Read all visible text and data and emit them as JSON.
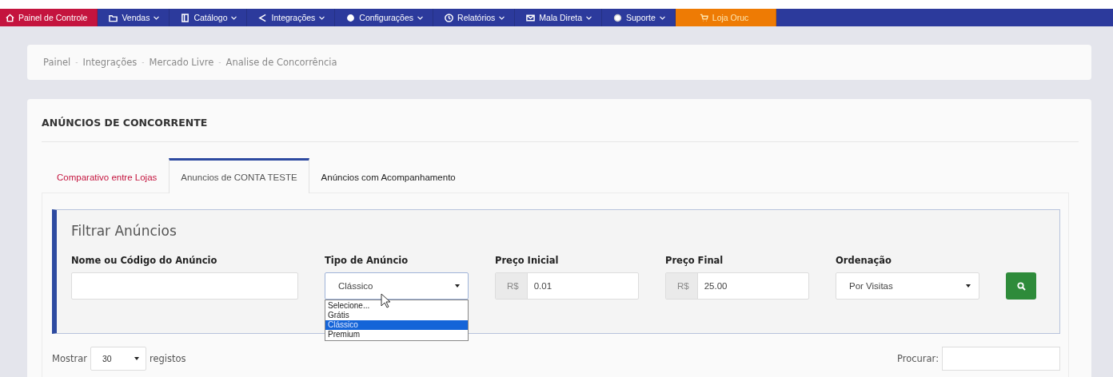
{
  "nav": [
    {
      "label": "Painel de Controle",
      "kind": "home",
      "caret": false
    },
    {
      "label": "Vendas",
      "kind": "menu",
      "caret": true
    },
    {
      "label": "Catálogo",
      "kind": "menu",
      "caret": true
    },
    {
      "label": "Integrações",
      "kind": "menu",
      "caret": true
    },
    {
      "label": "Configurações",
      "kind": "menu",
      "caret": true
    },
    {
      "label": "Relatórios",
      "kind": "menu",
      "caret": true
    },
    {
      "label": "Mala Direta",
      "kind": "menu",
      "caret": true
    },
    {
      "label": "Suporte",
      "kind": "menu",
      "caret": true
    },
    {
      "label": "Loja Oruc",
      "kind": "store",
      "caret": false
    }
  ],
  "breadcrumb": {
    "separator": "-",
    "items": [
      "Painel",
      "Integrações",
      "Mercado Livre",
      "Analise de Concorrência"
    ]
  },
  "title": "ANÚNCIOS DE CONCORRENTE",
  "tabs": [
    {
      "label": "Comparativo entre Lojas",
      "selected": false,
      "kind": "alert"
    },
    {
      "label": "Anuncios de CONTA TESTE",
      "selected": true,
      "kind": "normal"
    },
    {
      "label": "Anúncios com Acompanhamento",
      "selected": false,
      "kind": "normal"
    }
  ],
  "filter": {
    "title": "Filtrar Anúncios",
    "fields": [
      {
        "kind": "text",
        "label": "Nome ou Código do Anúncio"
      },
      {
        "kind": "select",
        "label": "Tipo de Anúncio",
        "value": "Clássico",
        "expanded": true,
        "options": [
          {
            "label": "Selecione...",
            "selected": false
          },
          {
            "label": "Grátis",
            "selected": false
          },
          {
            "label": "Clássico",
            "selected": true
          },
          {
            "label": "Premium",
            "selected": false
          }
        ]
      },
      {
        "kind": "money",
        "label": "Preço Inicial",
        "prefix": "R$",
        "value": "0.01"
      },
      {
        "kind": "money",
        "label": "Preço Final",
        "prefix": "R$",
        "value": "25.00"
      },
      {
        "kind": "select",
        "label": "Ordenação",
        "value": "Por Visitas",
        "expanded": false
      }
    ]
  },
  "table_controls": {
    "show_label": "Mostrar",
    "page_size": "30",
    "records_label": "registos",
    "search_label": "Procurar:"
  }
}
